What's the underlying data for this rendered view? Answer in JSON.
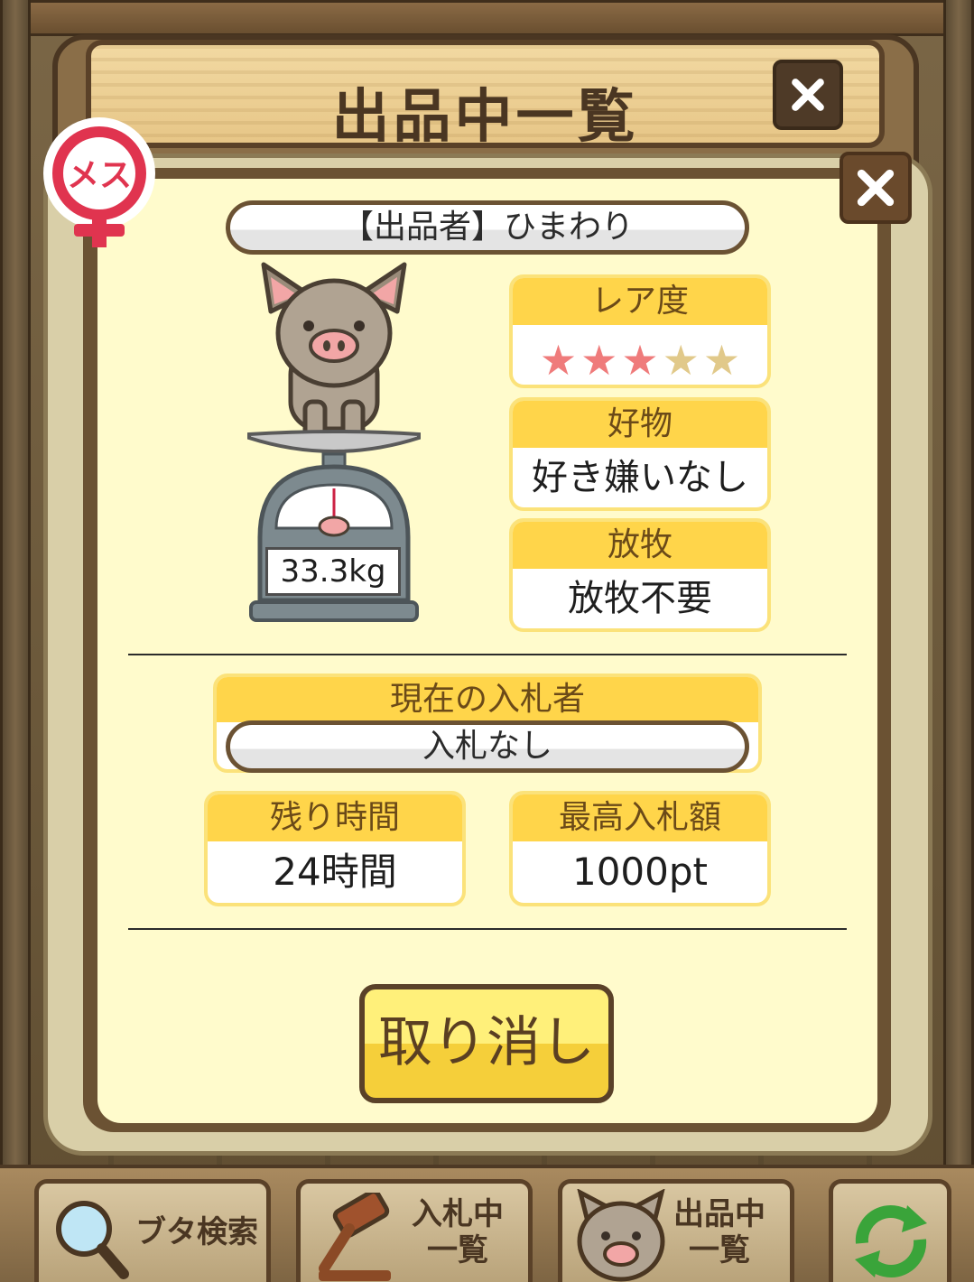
{
  "header": {
    "title": "出品中一覧"
  },
  "badge": {
    "gender_label": "メス"
  },
  "seller": {
    "text": "【出品者】ひまわり"
  },
  "pig": {
    "weight": "33.3kg"
  },
  "rarity": {
    "label": "レア度",
    "stars_filled": 3,
    "stars_total": 5,
    "star_glyph": "★"
  },
  "favorite_food": {
    "label": "好物",
    "value": "好き嫌いなし"
  },
  "grazing": {
    "label": "放牧",
    "value": "放牧不要"
  },
  "current_bidder": {
    "label": "現在の入札者",
    "value": "入札なし"
  },
  "remaining_time": {
    "label": "残り時間",
    "value": "24時間"
  },
  "max_bid": {
    "label": "最高入札額",
    "value": "1000pt"
  },
  "cancel_button": {
    "label": "取り消し"
  },
  "nav": {
    "search": {
      "label": "ブタ検索",
      "icon": "magnifier-icon"
    },
    "bidding": {
      "label_line1": "入札中",
      "label_line2": "一覧",
      "icon": "gavel-icon"
    },
    "listing": {
      "label_line1": "出品中",
      "label_line2": "一覧",
      "icon": "pig-icon"
    },
    "refresh": {
      "icon": "refresh-icon"
    }
  },
  "colors": {
    "panel": "#fffbcc",
    "header_yellow": "#ffd54a",
    "star_on": "#ef7b7b",
    "star_off": "#e1c98a",
    "frame_brown": "#6b5233"
  }
}
